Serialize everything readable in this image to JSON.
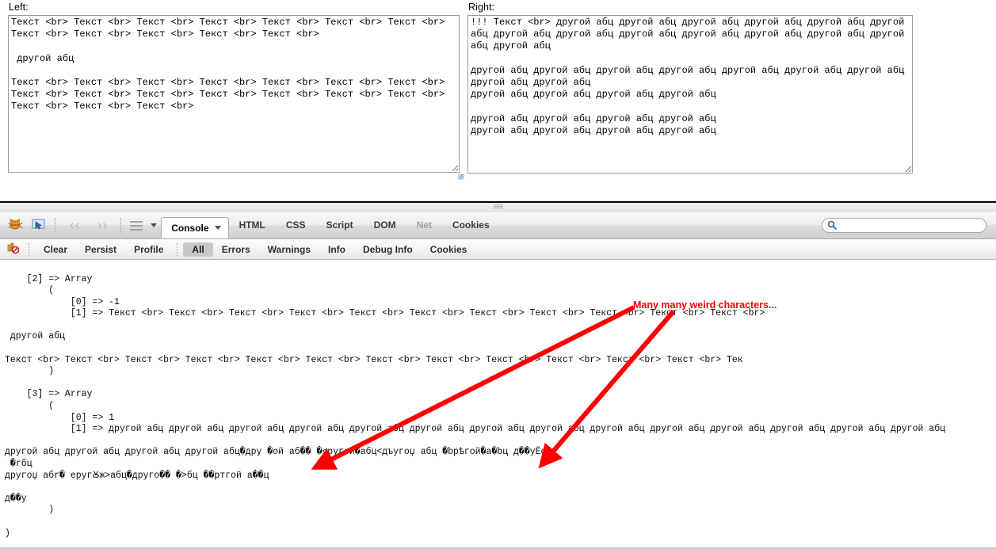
{
  "page": {
    "left": {
      "label": "Left:",
      "textarea_value": "Текст <br> Текст <br> Текст <br> Текст <br> Текст <br> Текст <br> Текст <br> Текст <br> Текст <br> Текст <br> Текст <br> Текст <br>\n\n другой абц\n\nТекст <br> Текст <br> Текст <br> Текст <br> Текст <br> Текст <br> Текст <br> Текст <br> Текст <br> Текст <br> Текст <br> Текст <br> Текст <br> Текст <br> Текст <br> Текст <br> Текст <br>"
    },
    "right": {
      "label": "Right:",
      "textarea_value": "!!! Текст <br> другой абц другой абц другой абц другой абц другой абц другой абц другой абц другой абц другой абц другой абц другой абц другой абц другой абц другой абц\n\nдругой абц другой абц другой абц другой абц другой абц другой абц другой абц другой абц другой абц\nдругой абц другой абц другой абц другой абц\n\nдругой абц другой абц другой абц другой абц\nдругой абц другой абц другой абц другой абц"
    }
  },
  "firebug": {
    "icons": {
      "logo": "firebug-bug-icon",
      "inspector": "inspect-element-icon",
      "prev": "back-chevron-icon",
      "next": "forward-chevron-icon",
      "menu": "list-menu-icon",
      "caret": "chevron-down-icon",
      "search": "search-icon",
      "console_filter": "console-filter-icon"
    },
    "tabs": [
      {
        "label": "Console",
        "active": true,
        "disabled": false
      },
      {
        "label": "HTML",
        "active": false,
        "disabled": false
      },
      {
        "label": "CSS",
        "active": false,
        "disabled": false
      },
      {
        "label": "Script",
        "active": false,
        "disabled": false
      },
      {
        "label": "DOM",
        "active": false,
        "disabled": false
      },
      {
        "label": "Net",
        "active": false,
        "disabled": true
      },
      {
        "label": "Cookies",
        "active": false,
        "disabled": false
      }
    ],
    "search": {
      "value": "",
      "placeholder": ""
    },
    "subtoolbar": [
      {
        "label": "Clear",
        "selected": false
      },
      {
        "label": "Persist",
        "selected": false
      },
      {
        "label": "Profile",
        "selected": false
      },
      {
        "label": "All",
        "selected": true
      },
      {
        "label": "Errors",
        "selected": false
      },
      {
        "label": "Warnings",
        "selected": false
      },
      {
        "label": "Info",
        "selected": false
      },
      {
        "label": "Debug Info",
        "selected": false
      },
      {
        "label": "Cookies",
        "selected": false
      }
    ],
    "console_output": "    [2] => Array\n        (\n            [0] => -1\n            [1] => Текст <br> Текст <br> Текст <br> Текст <br> Текст <br> Текст <br> Текст <br> Текст <br> Текст <br> Текст <br> Текст <br>\n\n другой абц\n\nТекст <br> Текст <br> Текст <br> Текст <br> Текст <br> Текст <br> Текст <br> Текст <br> Текст <br> Текст <br> Текст <br> Текст <br> Тек\n        )\n\n    [3] => Array\n        (\n            [0] => 1\n            [1] => другой абц другой абц другой абц другой абц другой абц другой абц другой абц другой абц другой абц другой абц другой абц другой абц другой абц другой абц\n\nдругой абц другой абц другой абц другой абц�дру �ой аб�� �<ругой�абц<дъугоџ абц �bpѣгой�а�bц д��yЁой\n �rбц\nдругоџ абr� еругꙊж>абц�друго�� �>бц ��ртгой а��ц\n\nд��y\n        )\n\n)"
  },
  "annotation": {
    "text": "Many many weird characters...",
    "color": "#ff0000"
  }
}
